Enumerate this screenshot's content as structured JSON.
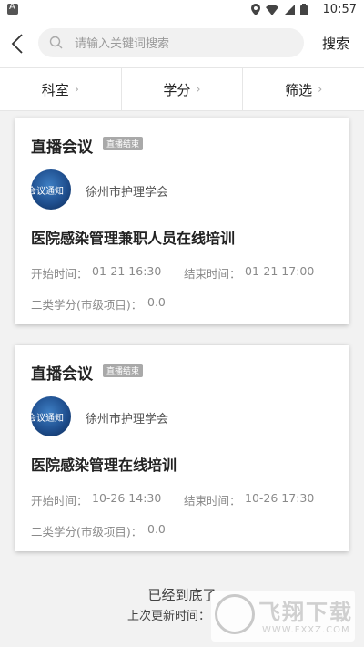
{
  "status_bar": {
    "time": "10:57"
  },
  "search": {
    "placeholder": "请输入关键词搜索",
    "button_label": "搜索"
  },
  "filters": [
    {
      "label": "科室"
    },
    {
      "label": "学分"
    },
    {
      "label": "筛选"
    }
  ],
  "cards": [
    {
      "type_label": "直播会议",
      "status_badge": "直播结束",
      "avatar_text": "会议通知",
      "organizer": "徐州市护理学会",
      "title": "医院感染管理兼职人员在线培训",
      "start_label": "开始时间：",
      "start_value": "01-21 16:30",
      "end_label": "结束时间：",
      "end_value": "01-21 17:00",
      "credit_label": "二类学分(市级项目)：",
      "credit_value": "0.0"
    },
    {
      "type_label": "直播会议",
      "status_badge": "直播结束",
      "avatar_text": "会议通知",
      "organizer": "徐州市护理学会",
      "title": "医院感染管理在线培训",
      "start_label": "开始时间：",
      "start_value": "10-26 14:30",
      "end_label": "结束时间：",
      "end_value": "10-26 17:30",
      "credit_label": "二类学分(市级项目)：",
      "credit_value": "0.0"
    }
  ],
  "footer": {
    "end_text": "已经到底了",
    "last_update_label": "上次更新时间："
  },
  "watermark": {
    "title": "飞翔下载",
    "url": "WWW.FXXZ.COM"
  }
}
